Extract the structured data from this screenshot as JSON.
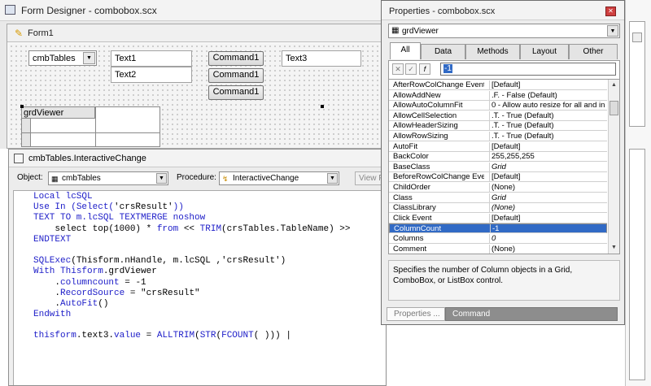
{
  "form_designer": {
    "title": "Form Designer - combobox.scx",
    "form": {
      "title": "Form1",
      "combo_value": "cmbTables",
      "textboxes": [
        "Text1",
        "Text2",
        "Text3"
      ],
      "commands": [
        "Command1",
        "Command1",
        "Command1"
      ],
      "grid_header": "grdViewer"
    }
  },
  "code_window": {
    "title": "cmbTables.InteractiveChange",
    "object_label": "Object:",
    "object_value": "cmbTables",
    "procedure_label": "Procedure:",
    "procedure_value": "InteractiveChange",
    "view_button": "View P",
    "lines": [
      [
        {
          "t": "Local lcSQL",
          "c": "#1c1cc8"
        }
      ],
      [
        {
          "t": "Use In (",
          "c": "#1c1cc8"
        },
        {
          "t": "Select",
          "c": "#1c1cc8"
        },
        {
          "t": "(",
          "c": "#1c1cc8"
        },
        {
          "t": "'crsResult'",
          "c": "#000000"
        },
        {
          "t": "))",
          "c": "#1c1cc8"
        }
      ],
      [
        {
          "t": "TEXT TO m.lcSQL TEXTMERGE noshow",
          "c": "#1c1cc8"
        }
      ],
      [
        {
          "t": "    select top(1000) * ",
          "c": "#000000"
        },
        {
          "t": "from",
          "c": "#1c1cc8"
        },
        {
          "t": " << ",
          "c": "#000000"
        },
        {
          "t": "TRIM",
          "c": "#1c1cc8"
        },
        {
          "t": "(crsTables.TableName) >>",
          "c": "#000000"
        }
      ],
      [
        {
          "t": "ENDTEXT",
          "c": "#1c1cc8"
        }
      ],
      [
        {
          "t": "",
          "c": "#000000"
        }
      ],
      [
        {
          "t": "SQLExec",
          "c": "#1c1cc8"
        },
        {
          "t": "(Thisform.nHandle, m.lcSQL ,'crsResult')",
          "c": "#000000"
        }
      ],
      [
        {
          "t": "With",
          "c": "#1c1cc8"
        },
        {
          "t": " ",
          "c": "#000000"
        },
        {
          "t": "Thisform",
          "c": "#1c1cc8"
        },
        {
          "t": ".grdViewer",
          "c": "#000000"
        }
      ],
      [
        {
          "t": "    .",
          "c": "#000000"
        },
        {
          "t": "columncount",
          "c": "#1c1cc8"
        },
        {
          "t": " = -1",
          "c": "#000000"
        }
      ],
      [
        {
          "t": "    .",
          "c": "#000000"
        },
        {
          "t": "RecordSource",
          "c": "#1c1cc8"
        },
        {
          "t": " = \"crsResult\"",
          "c": "#000000"
        }
      ],
      [
        {
          "t": "    .",
          "c": "#000000"
        },
        {
          "t": "AutoFit",
          "c": "#1c1cc8"
        },
        {
          "t": "()",
          "c": "#000000"
        }
      ],
      [
        {
          "t": "Endwith",
          "c": "#1c1cc8"
        }
      ],
      [
        {
          "t": "",
          "c": "#000000"
        }
      ],
      [
        {
          "t": "thisform",
          "c": "#1c1cc8"
        },
        {
          "t": ".text3.",
          "c": "#000000"
        },
        {
          "t": "value",
          "c": "#1c1cc8"
        },
        {
          "t": " = ",
          "c": "#000000"
        },
        {
          "t": "ALLTRIM",
          "c": "#1c1cc8"
        },
        {
          "t": "(",
          "c": "#000000"
        },
        {
          "t": "STR",
          "c": "#1c1cc8"
        },
        {
          "t": "(",
          "c": "#000000"
        },
        {
          "t": "FCOUNT",
          "c": "#1c1cc8"
        },
        {
          "t": "( ))) |",
          "c": "#000000"
        }
      ]
    ]
  },
  "properties": {
    "title": "Properties - combobox.scx",
    "object": "grdViewer",
    "tabs": [
      "All",
      "Data",
      "Methods",
      "Layout",
      "Other"
    ],
    "active_tab": "All",
    "edit_value": "-1",
    "rows": [
      {
        "name": "AfterRowColChange Event",
        "value": "[Default]",
        "italic": false
      },
      {
        "name": "AllowAddNew",
        "value": ".F. - False (Default)",
        "italic": false
      },
      {
        "name": "AllowAutoColumnFit",
        "value": "0 - Allow auto resize for all and in",
        "italic": false
      },
      {
        "name": "AllowCellSelection",
        "value": ".T. - True (Default)",
        "italic": false
      },
      {
        "name": "AllowHeaderSizing",
        "value": ".T. - True (Default)",
        "italic": false
      },
      {
        "name": "AllowRowSizing",
        "value": ".T. - True (Default)",
        "italic": false
      },
      {
        "name": "AutoFit",
        "value": "[Default]",
        "italic": false
      },
      {
        "name": "BackColor",
        "value": "255,255,255",
        "italic": false
      },
      {
        "name": "BaseClass",
        "value": "Grid",
        "italic": true
      },
      {
        "name": "BeforeRowColChange Event",
        "value": "[Default]",
        "italic": false
      },
      {
        "name": "ChildOrder",
        "value": "(None)",
        "italic": false
      },
      {
        "name": "Class",
        "value": "Grid",
        "italic": true
      },
      {
        "name": "ClassLibrary",
        "value": "(None)",
        "italic": true
      },
      {
        "name": "Click Event",
        "value": "[Default]",
        "italic": false
      },
      {
        "name": "ColumnCount",
        "value": "-1",
        "italic": false
      },
      {
        "name": "Columns",
        "value": "0",
        "italic": true
      },
      {
        "name": "Comment",
        "value": "(None)",
        "italic": false
      }
    ],
    "selected_row": 14,
    "description": "Specifies the number of Column objects in a Grid, ComboBox, or ListBox control.",
    "bottom_tabs": [
      "Properties ...",
      "Command"
    ]
  },
  "colors": {
    "selection": "#316ac5",
    "keyword": "#1c1cc8"
  }
}
